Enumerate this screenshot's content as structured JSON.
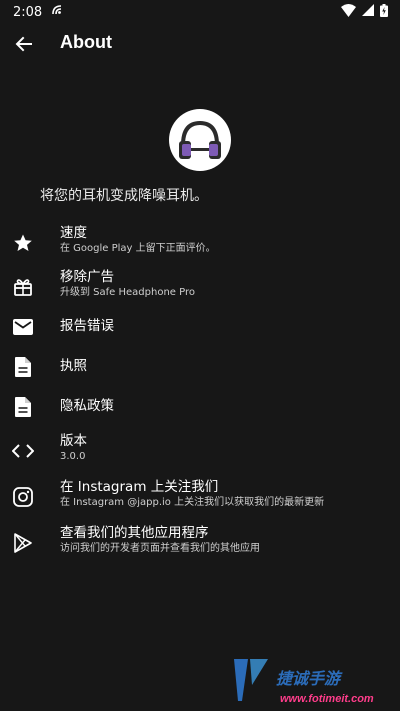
{
  "status_bar": {
    "time": "2:08"
  },
  "app_bar": {
    "title": "About"
  },
  "about": {
    "tagline": "将您的耳机变成降噪耳机。"
  },
  "menu": [
    {
      "title": "速度",
      "subtitle": "在 Google Play 上留下正面评价。",
      "icon": "star-icon"
    },
    {
      "title": "移除广告",
      "subtitle": "升级到 Safe Headphone Pro",
      "icon": "gift-icon"
    },
    {
      "title": "报告错误",
      "subtitle": "",
      "icon": "mail-icon"
    },
    {
      "title": "执照",
      "subtitle": "",
      "icon": "document-icon"
    },
    {
      "title": "隐私政策",
      "subtitle": "",
      "icon": "document-icon"
    },
    {
      "title": "版本",
      "subtitle": "3.0.0",
      "icon": "code-icon"
    },
    {
      "title": "在 Instagram 上关注我们",
      "subtitle": "在 Instagram @japp.io 上关注我们以获取我们的最新更新",
      "icon": "instagram-icon"
    },
    {
      "title": "查看我们的其他应用程序",
      "subtitle": "访问我们的开发者页面并查看我们的其他应用",
      "icon": "play-store-icon"
    }
  ],
  "watermark": {
    "title": "捷诚手游",
    "url": "www.fotimeit.com"
  },
  "colors": {
    "background": "#171717",
    "logo_accent": "#7e5bb5",
    "logo_dark": "#2b2b2b"
  }
}
